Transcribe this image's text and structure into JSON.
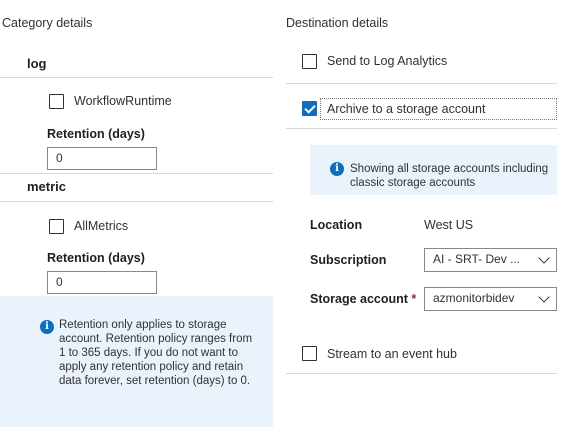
{
  "category": {
    "header": "Category details",
    "log": {
      "title": "log",
      "checkbox_label": "WorkflowRuntime",
      "checked": false,
      "retention_label": "Retention (days)",
      "retention_value": "0"
    },
    "metric": {
      "title": "metric",
      "checkbox_label": "AllMetrics",
      "checked": false,
      "retention_label": "Retention (days)",
      "retention_value": "0"
    },
    "info": {
      "icon": "info-icon",
      "text": "Retention only applies to storage account. Retention policy ranges from 1 to 365 days. If you do not want to apply any retention policy and retain data forever, set retention (days) to 0."
    }
  },
  "destination": {
    "header": "Destination details",
    "log_analytics": {
      "label": "Send to Log Analytics",
      "checked": false
    },
    "archive": {
      "label": "Archive to a storage account",
      "checked": true
    },
    "info": {
      "icon": "info-icon",
      "text": "Showing all storage accounts including classic storage accounts"
    },
    "location": {
      "label": "Location",
      "value": "West US"
    },
    "subscription": {
      "label": "Subscription",
      "value": "AI - SRT- Dev ..."
    },
    "storage_account": {
      "label": "Storage account",
      "required_mark": "*",
      "value": "azmonitorbidev"
    },
    "event_hub": {
      "label": "Stream to an event hub",
      "checked": false
    }
  },
  "colors": {
    "accent": "#0a6fc2",
    "info_bg": "#eaf3fb",
    "divider": "#d8d8d8",
    "required": "#a4262c"
  }
}
